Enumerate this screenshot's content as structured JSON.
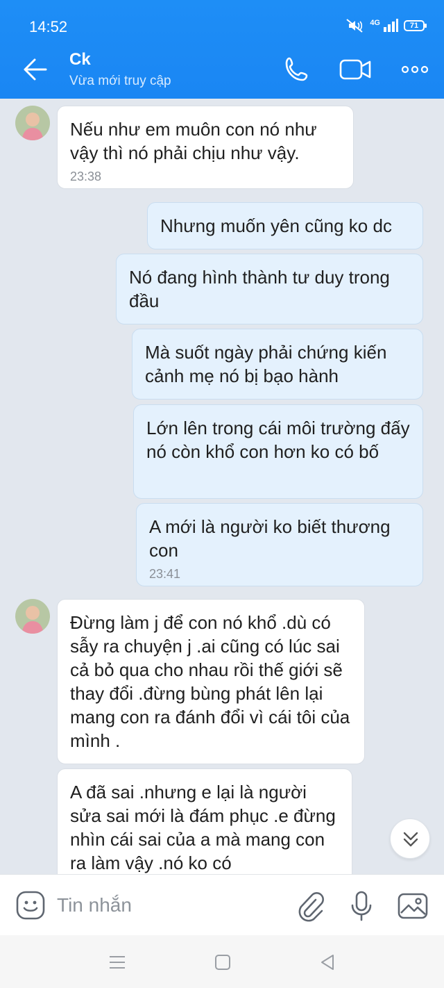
{
  "status_bar": {
    "time": "14:52",
    "network": "4G",
    "battery": "71"
  },
  "header": {
    "contact_name": "Ck",
    "contact_status": "Vừa mới truy cập"
  },
  "messages": [
    {
      "side": "in",
      "text": "Nếu như em muôn con nó như vậy thì nó phải chịu như vậy.",
      "time": "23:38"
    },
    {
      "side": "out",
      "text": "Nhưng muốn yên cũng ko dc"
    },
    {
      "side": "out",
      "text": "Nó đang hình thành tư duy trong đầu"
    },
    {
      "side": "out",
      "text": "Mà suốt ngày phải chứng kiến cảnh mẹ nó bị bạo hành"
    },
    {
      "side": "out",
      "text": "Lớn lên trong cái môi trường đấy nó còn khổ con hơn ko có bố"
    },
    {
      "side": "out",
      "text": "A mới là người ko biết thương con",
      "time": "23:41"
    },
    {
      "side": "in",
      "text": "Đừng làm j để con nó khổ .dù có sẫy ra chuyện j .ai cũng có lúc sai cả bỏ qua cho nhau rồi thế giới sẽ thay đổi .đừng bùng phát lên lại mang con ra đánh đổi vì cái tôi của mình ."
    },
    {
      "side": "in",
      "text": "A đã sai .nhưng e lại là người sửa sai mới là đám phục .e đừng nhìn cái sai của a mà mang con ra làm vậy .nó ko có"
    }
  ],
  "composer": {
    "placeholder": "Tin nhắn"
  },
  "icons": {
    "back": "arrow-left-icon",
    "call": "phone-icon",
    "video": "video-camera-icon",
    "more": "more-dots-icon",
    "emoji": "emoji-icon",
    "attach": "paperclip-icon",
    "mic": "microphone-icon",
    "image": "image-icon",
    "scroll": "chevron-double-down-icon"
  },
  "colors": {
    "header": "#1a86f3",
    "incoming_bubble": "#ffffff",
    "outgoing_bubble": "#e4f1fd",
    "background": "#e2e7ee"
  }
}
